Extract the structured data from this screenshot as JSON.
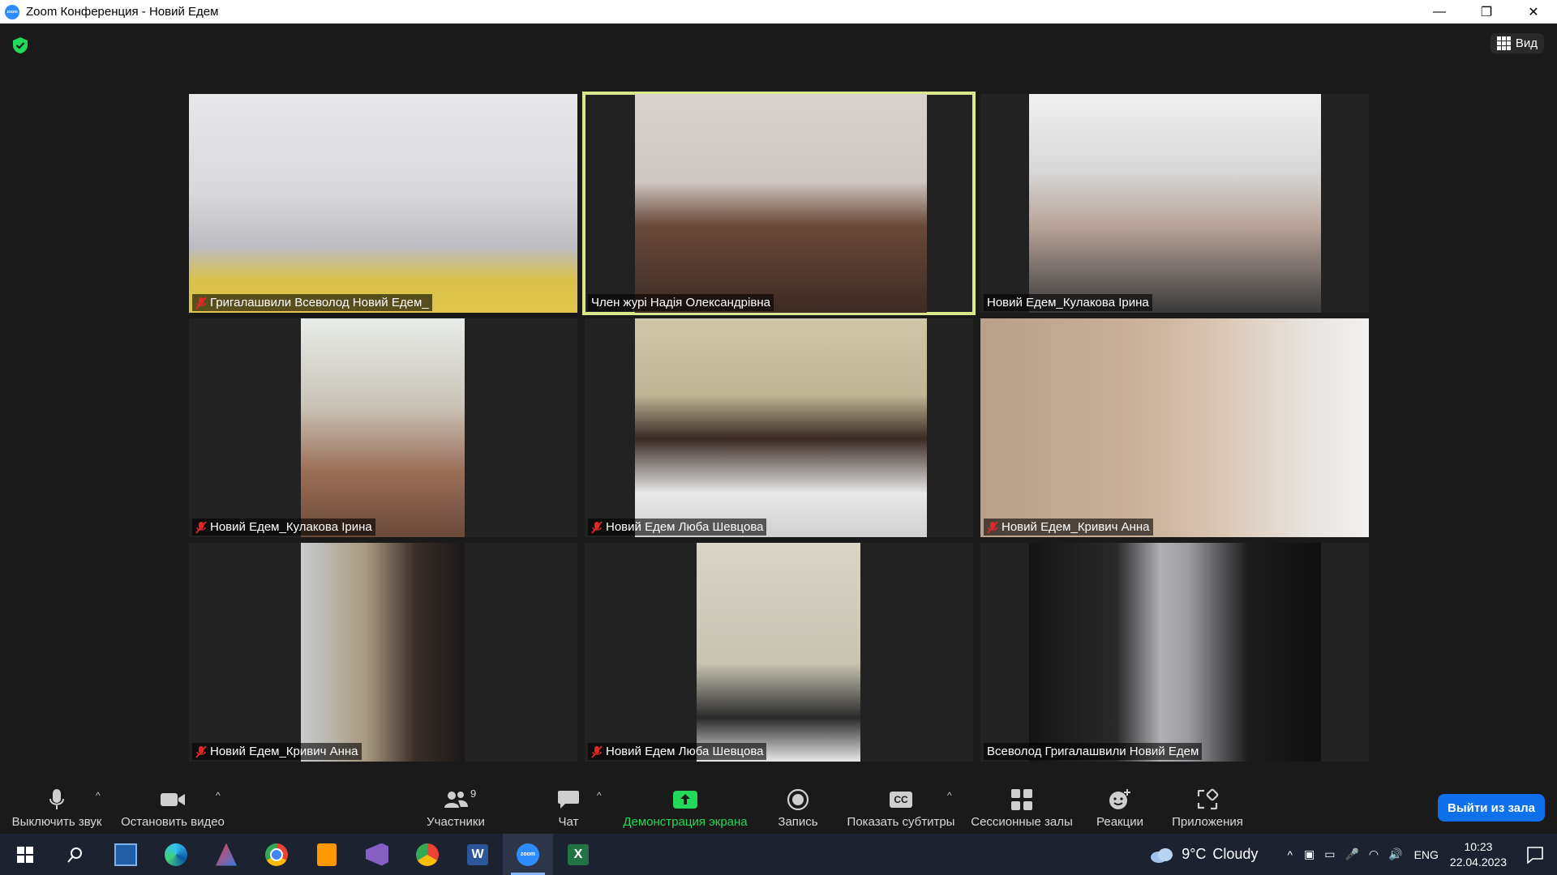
{
  "window": {
    "title": "Zoom Конференция - Новий Едем",
    "controls": {
      "minimize": "—",
      "restore": "❐",
      "close": "✕"
    }
  },
  "meeting": {
    "view_label": "Вид",
    "participants": [
      {
        "name": "Григалашвили Всеволод Новий Едем_",
        "muted": true,
        "active": false
      },
      {
        "name": "Член журі Надія Олександрівна",
        "muted": false,
        "active": true
      },
      {
        "name": "Новий Едем_Кулакова Ірина",
        "muted": false,
        "active": false
      },
      {
        "name": "Новий Едем_Кулакова Ірина",
        "muted": true,
        "active": false
      },
      {
        "name": "Новий Едем Люба Шевцова",
        "muted": true,
        "active": false
      },
      {
        "name": "Новий Едем_Кривич Анна",
        "muted": true,
        "active": false
      },
      {
        "name": "Новий Едем_Кривич Анна",
        "muted": true,
        "active": false
      },
      {
        "name": "Новий Едем Люба Шевцова",
        "muted": true,
        "active": false
      },
      {
        "name": "Всеволод Григалашвили Новий Едем",
        "muted": false,
        "active": false
      }
    ]
  },
  "toolbar": {
    "mute_label": "Выключить звук",
    "video_label": "Остановить видео",
    "participants_label": "Участники",
    "participants_count": "9",
    "chat_label": "Чат",
    "share_label": "Демонстрация экрана",
    "record_label": "Запись",
    "captions_label": "Показать субтитры",
    "captions_icon_text": "CC",
    "breakout_label": "Сессионные залы",
    "reactions_label": "Реакции",
    "apps_label": "Приложения",
    "leave_label": "Выйти из зала",
    "share_color": "#23d959",
    "leave_color": "#0e71eb"
  },
  "taskbar": {
    "apps": [
      "windows-start",
      "search",
      "virtualbox",
      "edge",
      "paint-tool",
      "chrome",
      "sublime-text",
      "visual-studio",
      "chrome-profile",
      "word",
      "zoom",
      "excel"
    ],
    "weather_temp": "9°C",
    "weather_text": "Cloudy",
    "language": "ENG",
    "time": "10:23",
    "date": "22.04.2023"
  }
}
